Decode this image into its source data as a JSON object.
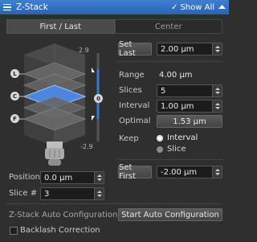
{
  "title": "Z-Stack",
  "show_all": "Show All",
  "tabs": [
    "First / Last",
    "Center"
  ],
  "diagram": {
    "top_value": "2.9",
    "bottom_value": "-2.9",
    "marker_last": "L",
    "marker_current": "C",
    "marker_first": "F",
    "marker_slider": "0"
  },
  "set_last": {
    "label": "Set Last",
    "value": "2.00 µm"
  },
  "range": {
    "label": "Range",
    "value": "4.00 µm"
  },
  "slices": {
    "label": "Slices",
    "value": "5"
  },
  "interval": {
    "label": "Interval",
    "value": "1.00 µm"
  },
  "optimal": {
    "label": "Optimal",
    "value": "1.53 µm"
  },
  "keep": {
    "label": "Keep",
    "options": [
      "Interval",
      "Slice"
    ],
    "selected": "Interval"
  },
  "set_first": {
    "label": "Set First",
    "value": "-2.00 µm"
  },
  "position": {
    "label": "Position",
    "value": "0.0 µm"
  },
  "slice_num": {
    "label": "Slice #",
    "value": "3"
  },
  "auto_config": {
    "label": "Z-Stack Auto Configuration",
    "button": "Start Auto Configuration"
  },
  "backlash": {
    "label": "Backlash Correction",
    "checked": false
  },
  "colors": {
    "accent": "#3a78d0",
    "panel": "#2f2f2f"
  }
}
